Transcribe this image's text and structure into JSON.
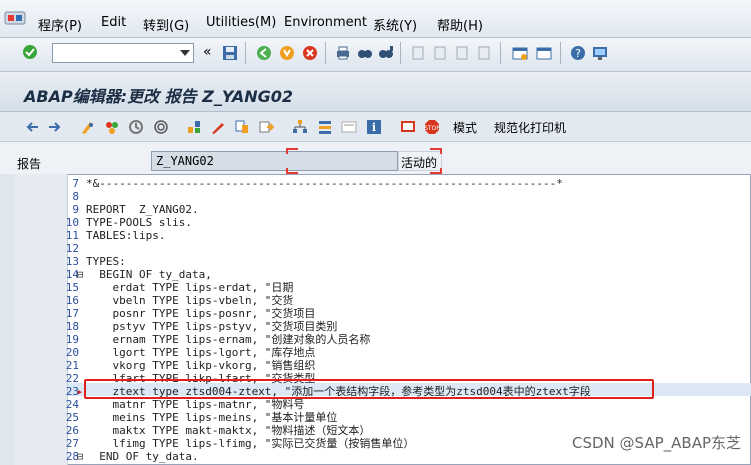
{
  "menu": {
    "items": [
      "程序(P)",
      "Edit",
      "转到(G)",
      "Utilities(M)",
      "Environment",
      "系统(Y)",
      "帮助(H)"
    ]
  },
  "command_field": {
    "value": ""
  },
  "toolbar_icons": [
    "enter-icon",
    "save-icon",
    "back-icon",
    "exit-icon",
    "cancel-icon",
    "print-icon",
    "find-icon",
    "find-next-icon",
    "first-page-icon",
    "previous-page-icon",
    "next-page-icon",
    "last-page-icon",
    "create-session-icon",
    "shortcut-icon",
    "help-icon",
    "customize-layout-icon"
  ],
  "title": "ABAP编辑器:更改 报告 Z_YANG02",
  "app_toolbar": {
    "mode_label": "模式",
    "pretty_printer_label": "规范化打印机"
  },
  "form": {
    "label": "报告",
    "program_name": "Z_YANG02",
    "status": "活动的"
  },
  "editor": {
    "lines": [
      {
        "num": "7",
        "marker": "",
        "text": "*&---------------------------------------------------------------------*"
      },
      {
        "num": "8",
        "marker": "",
        "text": ""
      },
      {
        "num": "9",
        "marker": "",
        "text": "REPORT  Z_YANG02."
      },
      {
        "num": "10",
        "marker": "",
        "text": "TYPE-POOLS slis."
      },
      {
        "num": "11",
        "marker": "",
        "text": "TABLES:lips."
      },
      {
        "num": "12",
        "marker": "",
        "text": ""
      },
      {
        "num": "13",
        "marker": "",
        "text": "TYPES:"
      },
      {
        "num": "14",
        "marker": "⊟",
        "text": "  BEGIN OF ty_data,"
      },
      {
        "num": "15",
        "marker": "",
        "text": "    erdat TYPE lips-erdat, \"日期"
      },
      {
        "num": "16",
        "marker": "",
        "text": "    vbeln TYPE lips-vbeln, \"交货"
      },
      {
        "num": "17",
        "marker": "",
        "text": "    posnr TYPE lips-posnr, \"交货项目"
      },
      {
        "num": "18",
        "marker": "",
        "text": "    pstyv TYPE lips-pstyv, \"交货项目类别"
      },
      {
        "num": "19",
        "marker": "",
        "text": "    ernam TYPE lips-ernam, \"创建对象的人员名称"
      },
      {
        "num": "20",
        "marker": "",
        "text": "    lgort TYPE lips-lgort, \"库存地点"
      },
      {
        "num": "21",
        "marker": "",
        "text": "    vkorg TYPE likp-vkorg, \"销售组织"
      },
      {
        "num": "22",
        "marker": "",
        "text": "    lfart TYPE likp-lfart, \"交货类型"
      },
      {
        "num": "23",
        "marker": "▸",
        "text": "    ztext type ztsd004-ztext, \"添加一个表结构字段，参考类型为ztsd004表中的ztext字段"
      },
      {
        "num": "24",
        "marker": "",
        "text": "    matnr TYPE lips-matnr, \"物料号"
      },
      {
        "num": "25",
        "marker": "",
        "text": "    meins TYPE lips-meins, \"基本计量单位"
      },
      {
        "num": "26",
        "marker": "",
        "text": "    maktx TYPE makt-maktx, \"物料描述（短文本）"
      },
      {
        "num": "27",
        "marker": "",
        "text": "    lfimg TYPE lips-lfimg, \"实际已交货量（按销售单位）"
      },
      {
        "num": "28",
        "marker": "⊟",
        "text": "  END OF ty_data."
      }
    ]
  },
  "watermark": "CSDN @SAP_ABAP东芝"
}
